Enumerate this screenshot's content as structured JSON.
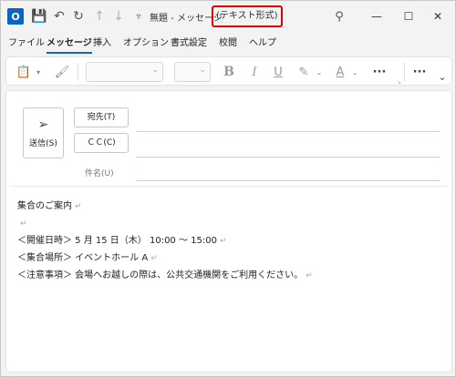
{
  "titlebar": {
    "title": "無題 - メッセージ",
    "format_label": "(テキスト形式)",
    "logo_letter": "O"
  },
  "menu": {
    "items": [
      "ファイル",
      "メッセージ",
      "挿入",
      "オプション",
      "書式設定",
      "校閲",
      "ヘルプ"
    ],
    "active": "メッセージ"
  },
  "ribbon": {
    "bold_label": "B"
  },
  "compose": {
    "send_label": "送信(S)",
    "to_label": "宛先(T)",
    "cc_label": "ＣＣ(C)",
    "subject_label": "件名(U)",
    "to_value": "",
    "cc_value": "",
    "subject_value": ""
  },
  "body": {
    "lines": [
      "集合のご案内",
      "",
      "＜開催日時＞ 5 月 15 日（木） 10:00 ～ 15:00",
      "＜集合場所＞ イベントホール A",
      "＜注意事項＞ 会場へお越しの際は、公共交通機関をご利用ください。"
    ],
    "paragraph_mark": "↵"
  },
  "colors": {
    "accent": "#0f6cbd",
    "highlight_box": "#e00000",
    "logo": "#0a64c2"
  }
}
